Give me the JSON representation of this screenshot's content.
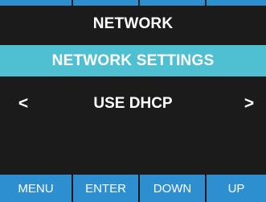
{
  "colors": {
    "background": "#1b1b1b",
    "accent_blue": "#2e8fd0",
    "subheader_teal": "#4fc0d2",
    "text": "#ffffff"
  },
  "screen": {
    "title": "NETWORK",
    "subtitle": "NETWORK SETTINGS"
  },
  "selector": {
    "prev_symbol": "<",
    "value": "USE DHCP",
    "next_symbol": ">"
  },
  "buttons": {
    "menu": "MENU",
    "enter": "ENTER",
    "down": "DOWN",
    "up": "UP"
  }
}
